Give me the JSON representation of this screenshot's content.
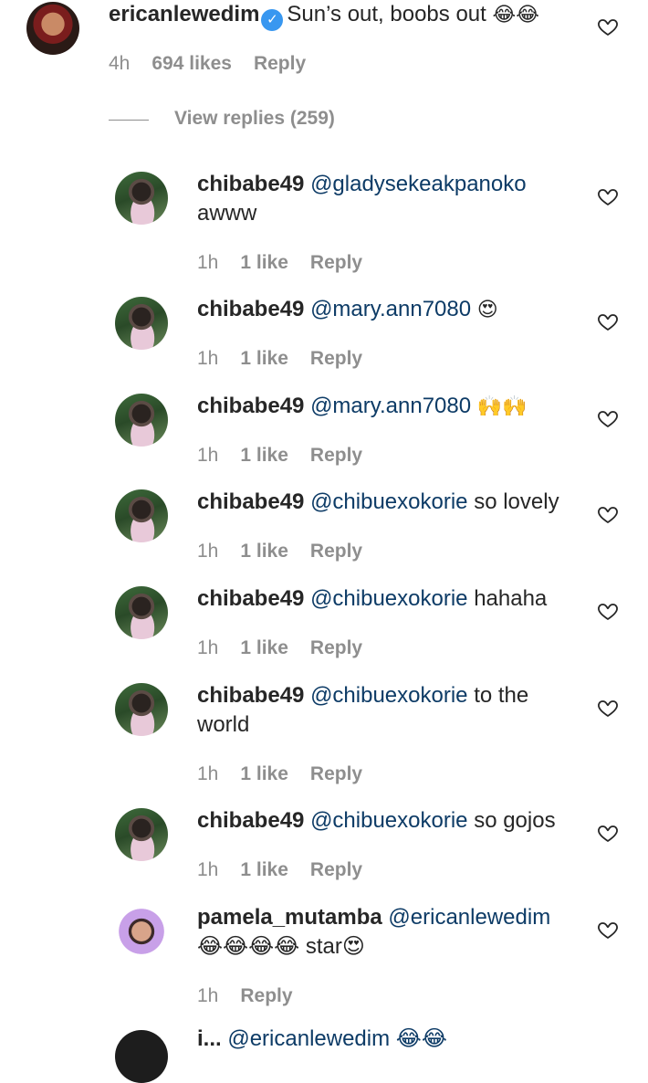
{
  "top_comment": {
    "username": "ericanlewedim",
    "text": "Sun’s out, boobs out",
    "emoji": "😂😂",
    "time": "4h",
    "likes": "694 likes",
    "reply": "Reply",
    "view_replies": "View replies (259)"
  },
  "replies": [
    {
      "username": "chibabe49",
      "mention": "@gladysekeakpanoko",
      "text": "",
      "line2": "awww",
      "time": "1h",
      "likes": "1 like",
      "reply": "Reply"
    },
    {
      "username": "chibabe49",
      "mention": "@mary.ann7080",
      "text": "😍",
      "line2": "",
      "time": "1h",
      "likes": "1 like",
      "reply": "Reply"
    },
    {
      "username": "chibabe49",
      "mention": "@mary.ann7080",
      "text": "🙌🙌",
      "line2": "",
      "time": "1h",
      "likes": "1 like",
      "reply": "Reply"
    },
    {
      "username": "chibabe49",
      "mention": "@chibuexokorie",
      "text": "so lovely",
      "line2": "",
      "time": "1h",
      "likes": "1 like",
      "reply": "Reply"
    },
    {
      "username": "chibabe49",
      "mention": "@chibuexokorie",
      "text": "hahaha",
      "line2": "",
      "time": "1h",
      "likes": "1 like",
      "reply": "Reply"
    },
    {
      "username": "chibabe49",
      "mention": "@chibuexokorie",
      "text": "to the",
      "line2": "world",
      "time": "1h",
      "likes": "1 like",
      "reply": "Reply"
    },
    {
      "username": "chibabe49",
      "mention": "@chibuexokorie",
      "text": "so gojos",
      "line2": "",
      "time": "1h",
      "likes": "1 like",
      "reply": "Reply"
    },
    {
      "username": "pamela_mutamba",
      "mention": "@ericanlewedim",
      "text": "",
      "line2": "😂😂😂😂 star😍",
      "time": "1h",
      "likes": "",
      "reply": "Reply"
    }
  ],
  "partial": {
    "username": "i...",
    "text": "@ericanlewedim 😂😂"
  },
  "icons": {
    "heart": "heart-outline-icon",
    "verified": "verified-badge-icon"
  }
}
